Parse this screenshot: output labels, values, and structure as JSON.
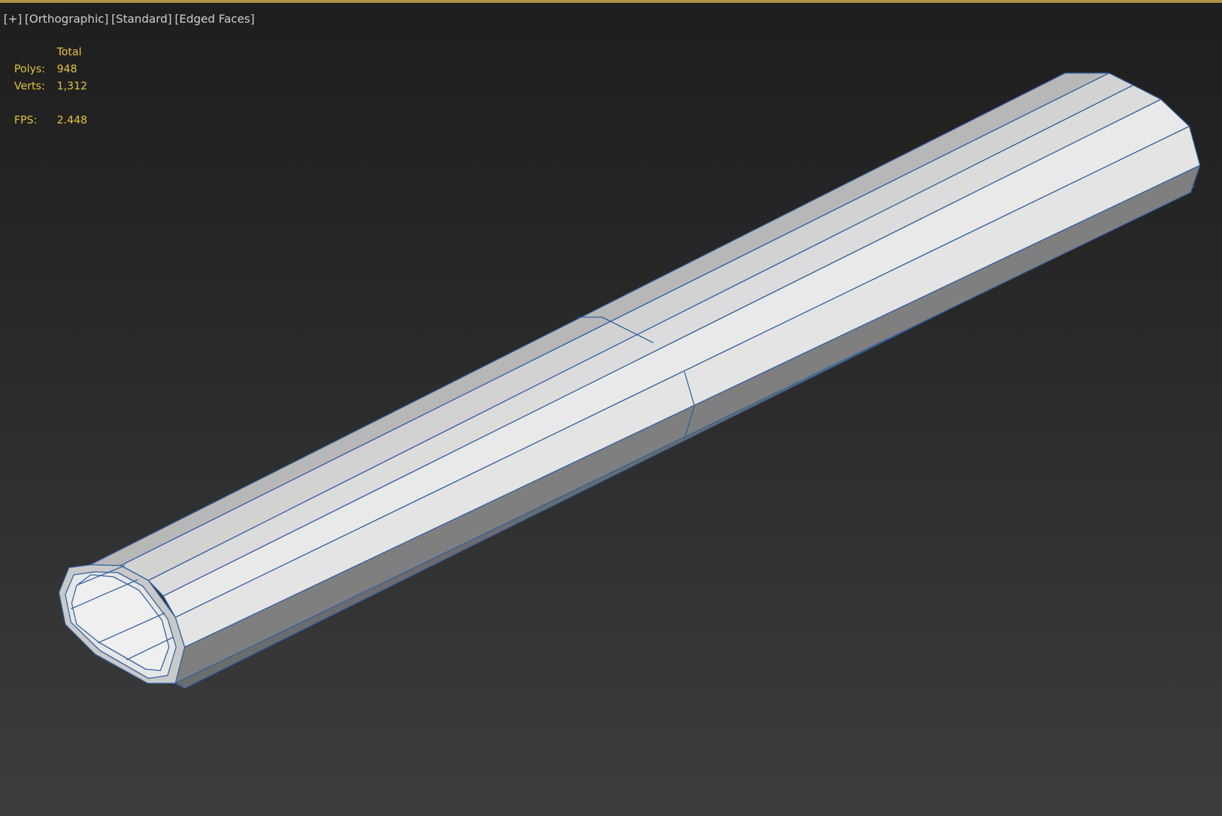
{
  "viewport": {
    "labels": [
      "[+]",
      "[Orthographic]",
      "[Standard]",
      "[Edged Faces]"
    ]
  },
  "stats": {
    "header": "Total",
    "polys_label": "Polys:",
    "polys_value": "948",
    "verts_label": "Verts:",
    "verts_value": "1,312",
    "fps_label": "FPS:",
    "fps_value": "2.448"
  },
  "colors": {
    "active_border": "#b0914a",
    "stats_text": "#e2c340",
    "edge_color": "#2e5f9e",
    "face_light": "#e9e9e9",
    "face_shadow": "#7a7a7a"
  },
  "scene": {
    "object": "octagonal-tube",
    "shading": "edged-faces"
  }
}
